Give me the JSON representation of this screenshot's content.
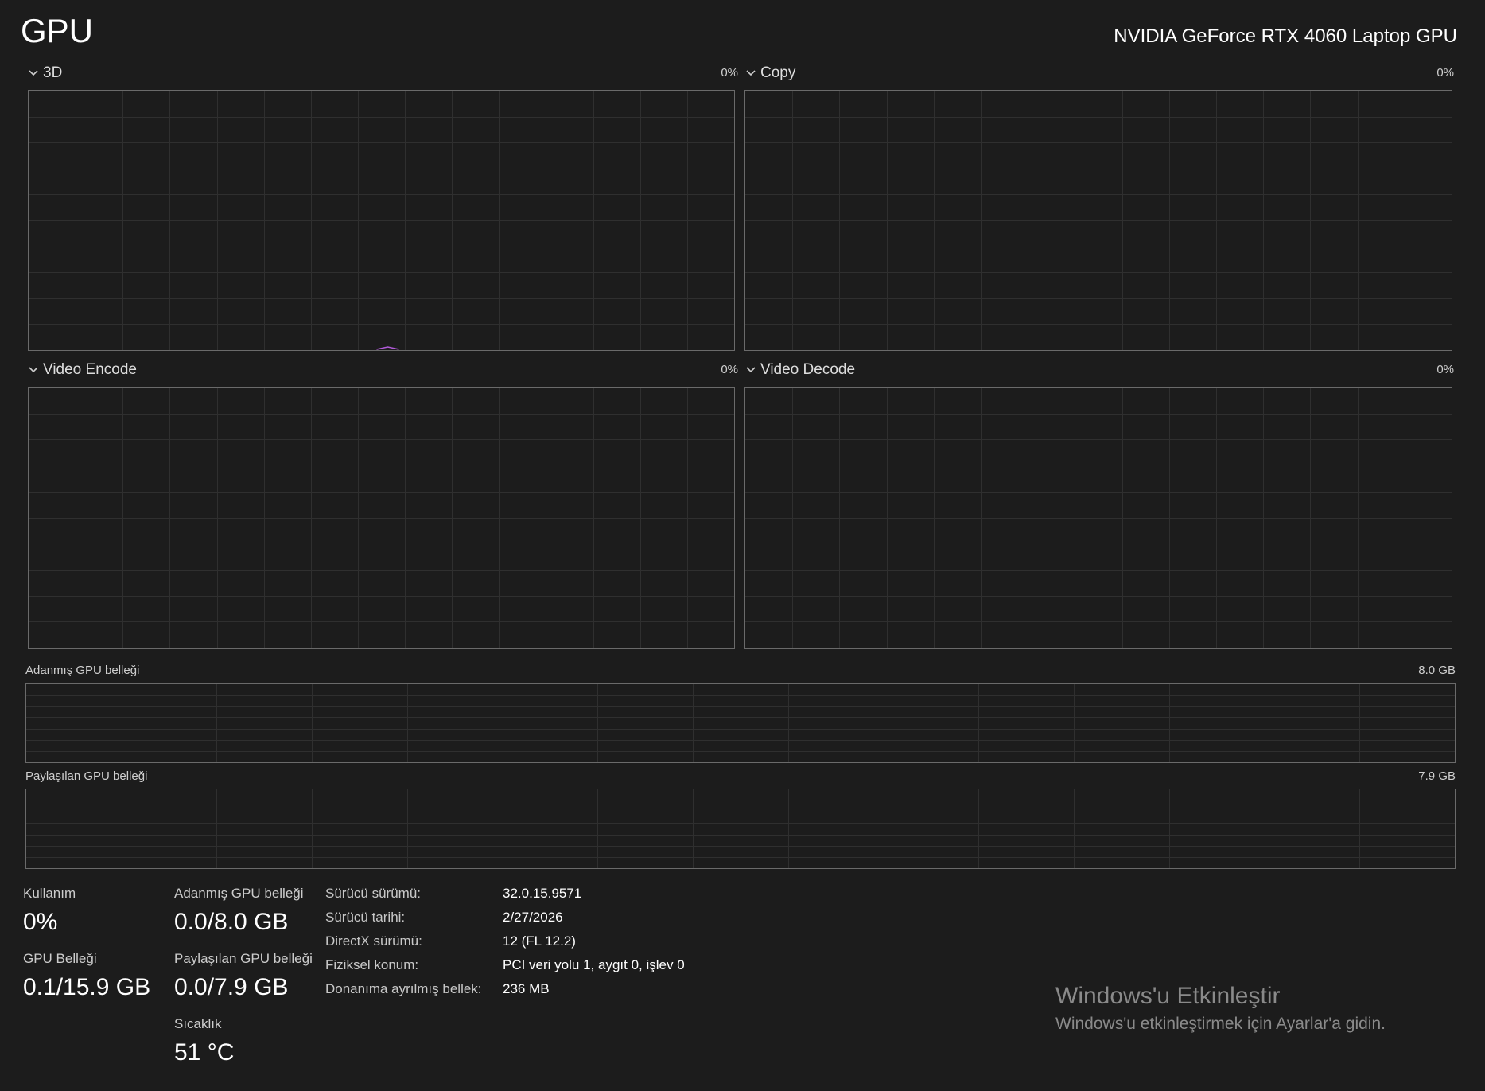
{
  "header": {
    "title": "GPU",
    "device_name": "NVIDIA GeForce RTX 4060 Laptop GPU"
  },
  "engines": [
    {
      "label": "3D",
      "percent": "0%"
    },
    {
      "label": "Copy",
      "percent": "0%"
    },
    {
      "label": "Video Encode",
      "percent": "0%"
    },
    {
      "label": "Video Decode",
      "percent": "0%"
    }
  ],
  "memory_graphs": {
    "dedicated": {
      "label": "Adanmış GPU belleği",
      "max": "8.0 GB"
    },
    "shared": {
      "label": "Paylaşılan GPU belleği",
      "max": "7.9 GB"
    }
  },
  "stats": {
    "utilization": {
      "label": "Kullanım",
      "value": "0%"
    },
    "dedicated_memory": {
      "label": "Adanmış GPU belleği",
      "value": "0.0/8.0 GB"
    },
    "gpu_memory": {
      "label": "GPU Belleği",
      "value": "0.1/15.9 GB"
    },
    "shared_memory": {
      "label": "Paylaşılan GPU belleği",
      "value": "0.0/7.9 GB"
    },
    "temperature": {
      "label": "Sıcaklık",
      "value": "51 °C"
    }
  },
  "info": [
    {
      "key": "Sürücü sürümü:",
      "value": "32.0.15.9571"
    },
    {
      "key": "Sürücü tarihi:",
      "value": "2/27/2026"
    },
    {
      "key": "DirectX sürümü:",
      "value": "12 (FL 12.2)"
    },
    {
      "key": "Fiziksel konum:",
      "value": "PCI veri yolu 1, aygıt 0, işlev 0"
    },
    {
      "key": "Donanıma ayrılmış bellek:",
      "value": "236 MB"
    }
  ],
  "watermark": {
    "title": "Windows'u Etkinleştir",
    "subtitle": "Windows'u etkinleştirmek için Ayarlar'a gidin."
  },
  "colors": {
    "background": "#1c1c1c",
    "graph_border": "#6a6a6a",
    "grid_line": "#2f2f2f",
    "accent_gpu": "#b05ad8"
  }
}
